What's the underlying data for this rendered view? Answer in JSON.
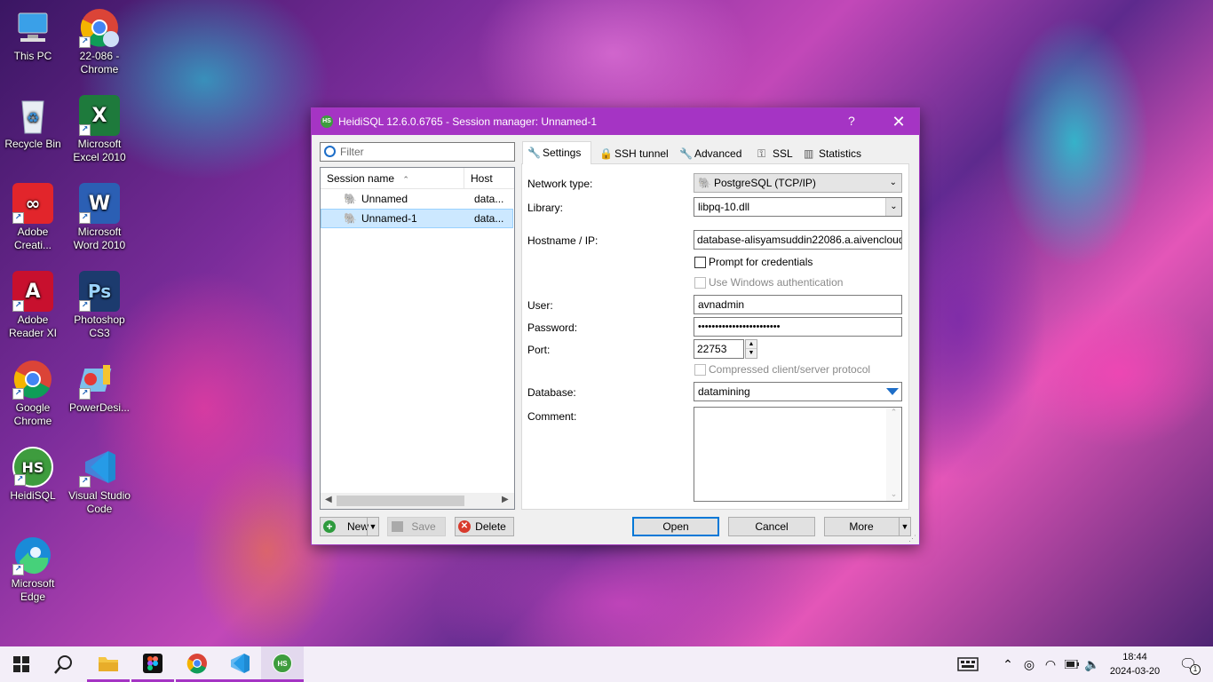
{
  "desktop": {
    "icons": [
      {
        "label1": "This PC",
        "label2": ""
      },
      {
        "label1": "22-086 -",
        "label2": "Chrome"
      },
      {
        "label1": "Recycle Bin",
        "label2": ""
      },
      {
        "label1": "Microsoft",
        "label2": "Excel 2010"
      },
      {
        "label1": "Adobe",
        "label2": "Creati..."
      },
      {
        "label1": "Microsoft",
        "label2": "Word 2010"
      },
      {
        "label1": "Adobe",
        "label2": "Reader XI"
      },
      {
        "label1": "Photoshop",
        "label2": "CS3"
      },
      {
        "label1": "Google",
        "label2": "Chrome"
      },
      {
        "label1": "PowerDesi...",
        "label2": ""
      },
      {
        "label1": "HeidiSQL",
        "label2": ""
      },
      {
        "label1": "Visual Studio",
        "label2": "Code"
      },
      {
        "label1": "Microsoft",
        "label2": "Edge"
      }
    ]
  },
  "dialog": {
    "title": "HeidiSQL 12.6.0.6765 - Session manager: Unnamed-1",
    "help": "?",
    "close": "✕",
    "filter_placeholder": "Filter",
    "columns": {
      "name": "Session name",
      "host": "Host"
    },
    "sessions": [
      {
        "name": "Unnamed",
        "host": "data..."
      },
      {
        "name": "Unnamed-1",
        "host": "data..."
      }
    ],
    "buttons": {
      "new": "New",
      "save": "Save",
      "delete": "Delete",
      "open": "Open",
      "cancel": "Cancel",
      "more": "More"
    },
    "tabs": [
      "Settings",
      "SSH tunnel",
      "Advanced",
      "SSL",
      "Statistics"
    ],
    "form": {
      "network_type_label": "Network type:",
      "network_type": "PostgreSQL (TCP/IP)",
      "library_label": "Library:",
      "library": "libpq-10.dll",
      "hostname_label": "Hostname / IP:",
      "hostname": "database-alisyamsuddin22086.a.aivencloud",
      "prompt_credentials": "Prompt for credentials",
      "windows_auth": "Use Windows authentication",
      "user_label": "User:",
      "user": "avnadmin",
      "password_label": "Password:",
      "password": "••••••••••••••••••••••••",
      "port_label": "Port:",
      "port": "22753",
      "compressed": "Compressed client/server protocol",
      "database_label": "Database:",
      "database": "datamining",
      "comment_label": "Comment:"
    }
  },
  "taskbar": {
    "time": "18:44",
    "date": "2024-03-20",
    "notification_count": "1"
  },
  "colors": {
    "accent": "#a534c4",
    "selection": "#cce8ff"
  }
}
